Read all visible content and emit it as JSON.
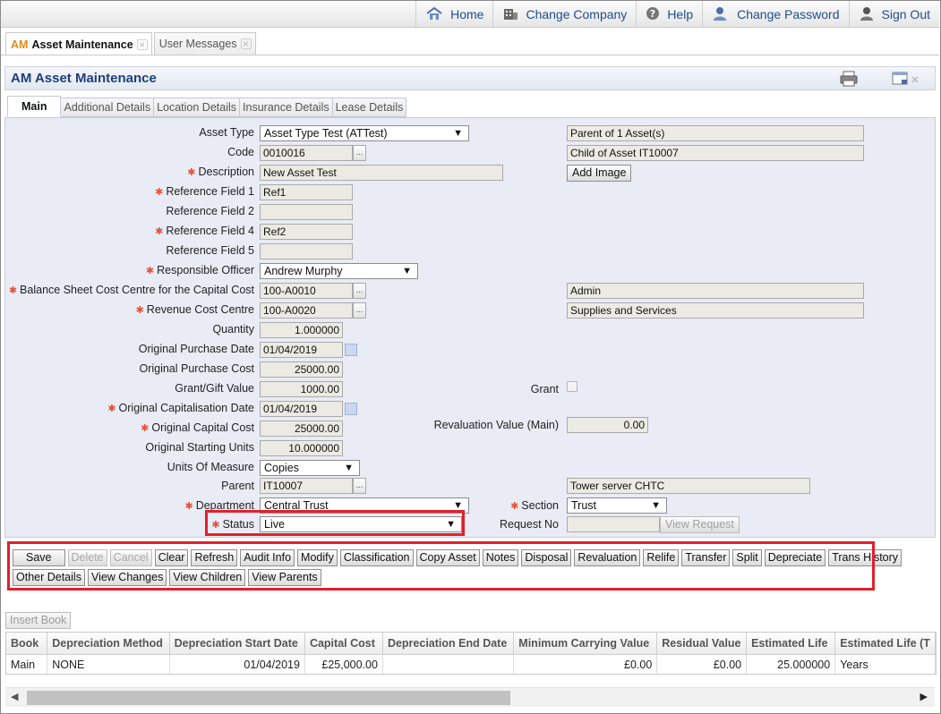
{
  "topnav": {
    "home": "Home",
    "change_company": "Change Company",
    "help": "Help",
    "change_password": "Change Password",
    "sign_out": "Sign Out"
  },
  "doc_tabs": {
    "asset_prefix": "AM",
    "asset_label": "Asset Maintenance",
    "messages_label": "User Messages"
  },
  "panel": {
    "title": "AM Asset Maintenance"
  },
  "sub_tabs": [
    "Main",
    "Additional Details",
    "Location Details",
    "Insurance Details",
    "Lease Details"
  ],
  "form": {
    "asset_type": {
      "label": "Asset Type",
      "value": "Asset Type Test (ATTest)"
    },
    "parent_of": "Parent of 1 Asset(s)",
    "child_of": "Child of Asset IT10007",
    "code": {
      "label": "Code",
      "value": "0010016"
    },
    "description": {
      "label": "Description",
      "value": "New Asset Test"
    },
    "add_image": "Add Image",
    "ref1": {
      "label": "Reference Field 1",
      "value": "Ref1"
    },
    "ref2": {
      "label": "Reference Field 2",
      "value": ""
    },
    "ref4": {
      "label": "Reference Field 4",
      "value": "Ref2"
    },
    "ref5": {
      "label": "Reference Field 5",
      "value": ""
    },
    "responsible_officer": {
      "label": "Responsible Officer",
      "value": "Andrew Murphy"
    },
    "bs_cost_centre": {
      "label": "Balance Sheet Cost Centre for the Capital Cost",
      "value": "100-A0010",
      "desc": "Admin"
    },
    "rev_cost_centre": {
      "label": "Revenue Cost Centre",
      "value": "100-A0020",
      "desc": "Supplies and Services"
    },
    "quantity": {
      "label": "Quantity",
      "value": "1.000000"
    },
    "orig_purchase_date": {
      "label": "Original Purchase Date",
      "value": "01/04/2019"
    },
    "orig_purchase_cost": {
      "label": "Original Purchase Cost",
      "value": "25000.00"
    },
    "grant_gift_value": {
      "label": "Grant/Gift Value",
      "value": "1000.00"
    },
    "grant": {
      "label": "Grant"
    },
    "orig_cap_date": {
      "label": "Original Capitalisation Date",
      "value": "01/04/2019"
    },
    "orig_cap_cost": {
      "label": "Original Capital Cost",
      "value": "25000.00"
    },
    "revaluation_value": {
      "label": "Revaluation Value (Main)",
      "value": "0.00"
    },
    "orig_starting_units": {
      "label": "Original Starting Units",
      "value": "10.000000"
    },
    "units_of_measure": {
      "label": "Units Of Measure",
      "value": "Copies"
    },
    "parent": {
      "label": "Parent",
      "value": "IT10007",
      "desc": "Tower server CHTC"
    },
    "department": {
      "label": "Department",
      "value": "Central Trust"
    },
    "section": {
      "label": "Section",
      "value": "Trust"
    },
    "status": {
      "label": "Status",
      "value": "Live"
    },
    "request_no": {
      "label": "Request No",
      "value": ""
    },
    "view_request": "View Request"
  },
  "actions_row1": [
    "Save",
    "Delete",
    "Cancel",
    "Clear",
    "Refresh",
    "Audit Info",
    "Modify",
    "Classification",
    "Copy Asset",
    "Notes",
    "Disposal",
    "Revaluation",
    "Relife",
    "Transfer",
    "Split",
    "Depreciate",
    "Trans History"
  ],
  "actions_row2": [
    "Other Details",
    "View Changes",
    "View Children",
    "View Parents"
  ],
  "insert_book": "Insert Book",
  "grid": {
    "headers": [
      "Book",
      "Depreciation Method",
      "Depreciation Start Date",
      "Capital Cost",
      "Depreciation End Date",
      "Minimum Carrying Value",
      "Residual Value",
      "Estimated Life",
      "Estimated Life (T"
    ],
    "rows": [
      [
        "Main",
        "NONE",
        "01/04/2019",
        "£25,000.00",
        "",
        "£0.00",
        "£0.00",
        "25.000000",
        "Years"
      ]
    ]
  }
}
